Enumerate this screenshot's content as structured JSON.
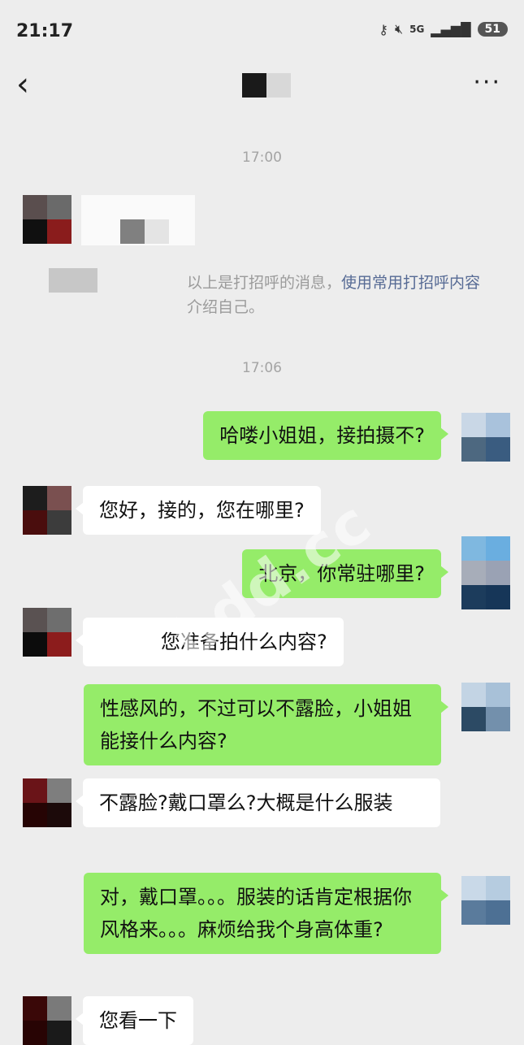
{
  "status": {
    "time": "21:17",
    "network": "5G",
    "battery": "51"
  },
  "header": {
    "back_icon": "chevron-left-icon",
    "more_icon": "more-horizontal-icon"
  },
  "timestamps": [
    "17:00",
    "17:06"
  ],
  "system_notice": {
    "text": "以上是打招呼的消息，",
    "link": "使用常用打招呼内容",
    "suffix": "介绍自己。"
  },
  "messages": [
    {
      "side": "right",
      "text": "哈喽小姐姐，接拍摄不?"
    },
    {
      "side": "left",
      "text": "您好，接的，您在哪里?"
    },
    {
      "side": "right",
      "text": "北京，你常驻哪里?"
    },
    {
      "side": "left",
      "text": "您准备拍什么内容?"
    },
    {
      "side": "right",
      "text": "性感风的，不过可以不露脸，小姐姐能接什么内容?"
    },
    {
      "side": "left",
      "text": "不露脸?戴口罩么?大概是什么服装"
    },
    {
      "side": "right",
      "text": "对，戴口罩。。。服装的话肯定根据你风格来。。。麻烦给我个身高体重?"
    },
    {
      "side": "left",
      "text": "您看一下"
    }
  ],
  "watermark": "bdd.cc",
  "colors": {
    "background": "#ededed",
    "right_bubble": "#95ec69",
    "left_bubble": "#ffffff",
    "link": "#576b95"
  }
}
